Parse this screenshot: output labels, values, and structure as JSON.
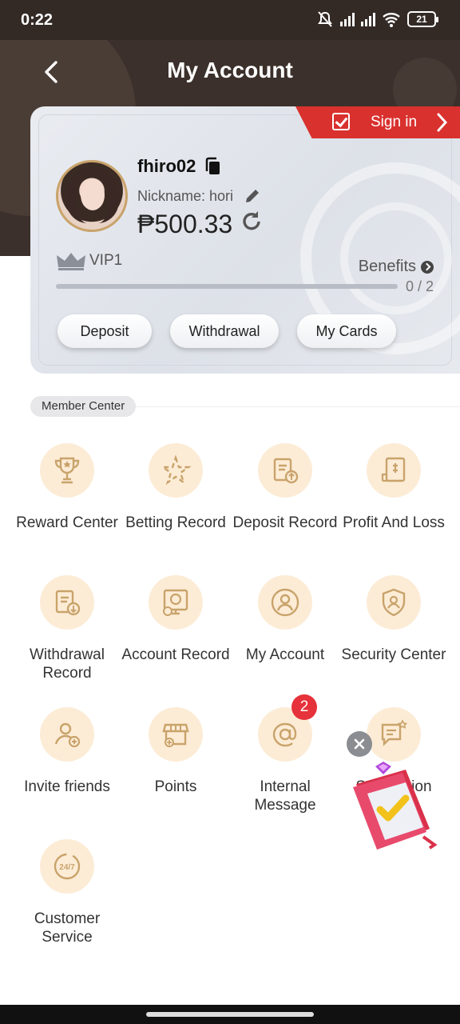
{
  "status_bar": {
    "time": "0:22",
    "battery": "21"
  },
  "header": {
    "title": "My Account"
  },
  "signin": {
    "label": "Sign in"
  },
  "profile": {
    "username": "fhiro02",
    "nickname": "Nickname: hori",
    "balance": "₱500.33",
    "vip_level": "VIP1",
    "benefits_label": "Benefits",
    "progress_text": "0 / 2",
    "progress_fraction": 0
  },
  "actions": {
    "deposit": "Deposit",
    "withdrawal": "Withdrawal",
    "my_cards": "My Cards"
  },
  "member_center": {
    "tag": "Member Center",
    "items": [
      {
        "label": "Reward Center",
        "icon": "trophy-icon"
      },
      {
        "label": "Betting Record",
        "icon": "betting-record-icon"
      },
      {
        "label": "Deposit Record",
        "icon": "deposit-record-icon"
      },
      {
        "label": "Profit And Loss",
        "icon": "profit-loss-icon"
      },
      {
        "label": "Withdrawal Record",
        "icon": "withdrawal-record-icon"
      },
      {
        "label": "Account Record",
        "icon": "account-record-icon"
      },
      {
        "label": "My Account",
        "icon": "user-icon"
      },
      {
        "label": "Security Center",
        "icon": "shield-icon"
      },
      {
        "label": "Invite friends",
        "icon": "invite-icon"
      },
      {
        "label": "Points",
        "icon": "store-icon"
      },
      {
        "label": "Internal Message",
        "icon": "at-icon",
        "badge": "2"
      },
      {
        "label": "Suggestion",
        "icon": "suggestion-icon"
      },
      {
        "label": "Customer Service",
        "icon": "support-24-7-icon"
      }
    ]
  },
  "colors": {
    "header_bg": "#3b302b",
    "accent": "#d9312e",
    "icon_bg": "#fcecd6",
    "icon_stroke": "#c9a36b"
  }
}
